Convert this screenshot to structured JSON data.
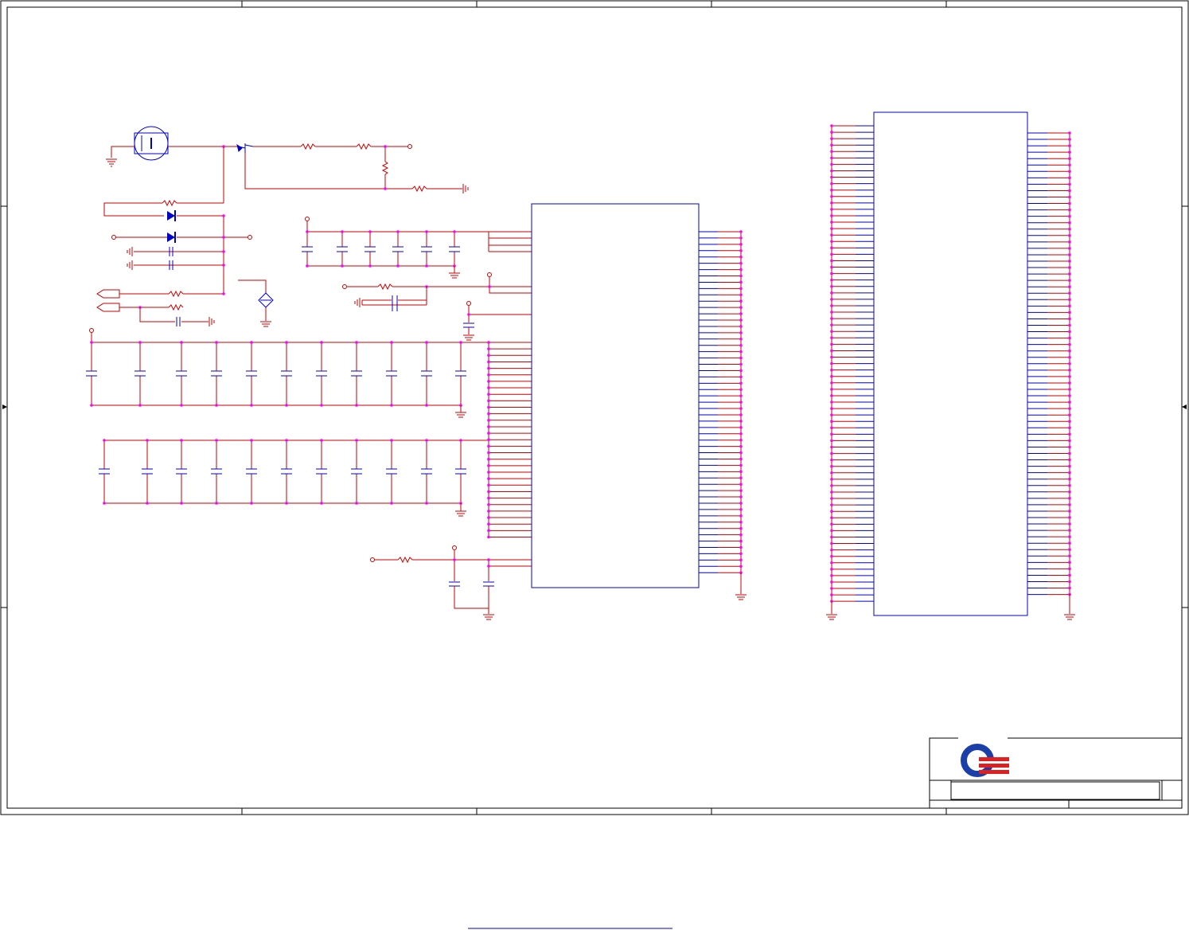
{
  "sheet": {
    "title_block": {
      "logo_icon": "quanta-logo-icon",
      "brand_red": "#e02020",
      "brand_blue": "#1a3fa8"
    },
    "footer_link_text": ""
  },
  "colors": {
    "wire": "#cc0000",
    "part": "#0000cc",
    "pin_dot": "#ff00ff",
    "frame": "#000000"
  },
  "components": {
    "main_ic": {
      "left_pins": 56,
      "right_pins": 55
    },
    "connector_ic": {
      "left_pins": 75,
      "right_pins": 73
    },
    "decoupling_row_1": {
      "caps": 11
    },
    "decoupling_row_2": {
      "caps": 11
    }
  }
}
